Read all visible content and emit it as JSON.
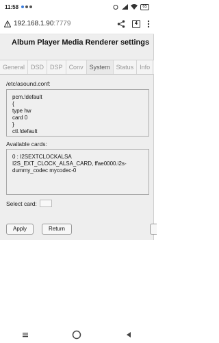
{
  "status_bar": {
    "time": "11:58",
    "battery": "65"
  },
  "browser": {
    "url_host": "192.168.1.90",
    "url_port": ":7779",
    "tab_count": "4"
  },
  "page": {
    "title": "Album Player Media Renderer settings",
    "tabs": [
      "General",
      "DSD",
      "DSP",
      "Conv",
      "System",
      "Status",
      "Info"
    ],
    "config_label": "/etc/asound.conf:",
    "config_lines": [
      "pcm.!default",
      "{",
      "type hw",
      "card 0",
      "}",
      "ctl.!default"
    ],
    "cards_label": "Available cards:",
    "cards_lines": [
      "0 : I2SEXTCLOCKALSA",
      "I2S_EXT_CLOCK_ALSA_CARD, ffae0000.i2s-",
      "dummy_codec mycodec-0"
    ],
    "select_label": "Select card:",
    "apply_label": "Apply",
    "return_label": "Return"
  }
}
